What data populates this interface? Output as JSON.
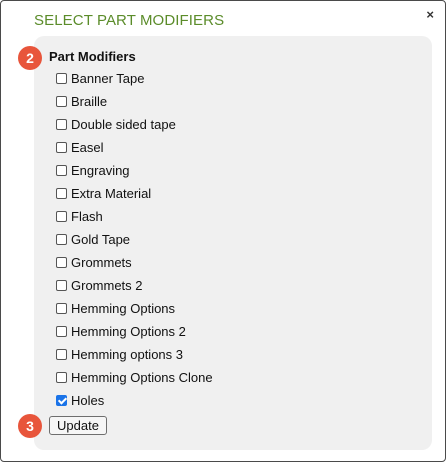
{
  "dialog": {
    "title": "SELECT PART MODIFIERS",
    "close_label": "×"
  },
  "section": {
    "heading": "Part Modifiers",
    "step_badge": "2"
  },
  "modifiers": [
    {
      "label": "Banner Tape",
      "checked": false
    },
    {
      "label": "Braille",
      "checked": false
    },
    {
      "label": "Double sided tape",
      "checked": false
    },
    {
      "label": "Easel",
      "checked": false
    },
    {
      "label": "Engraving",
      "checked": false
    },
    {
      "label": "Extra Material",
      "checked": false
    },
    {
      "label": "Flash",
      "checked": false
    },
    {
      "label": "Gold Tape",
      "checked": false
    },
    {
      "label": "Grommets",
      "checked": false
    },
    {
      "label": "Grommets 2",
      "checked": false
    },
    {
      "label": "Hemming Options",
      "checked": false
    },
    {
      "label": "Hemming Options 2",
      "checked": false
    },
    {
      "label": "Hemming options 3",
      "checked": false
    },
    {
      "label": "Hemming Options Clone",
      "checked": false
    },
    {
      "label": "Holes",
      "checked": true
    }
  ],
  "footer": {
    "step_badge": "3",
    "update_label": "Update"
  },
  "colors": {
    "title": "#5b8c2a",
    "badge": "#e8553b",
    "checkbox_checked": "#1a73e8",
    "panel_bg": "#f0f0f0"
  }
}
